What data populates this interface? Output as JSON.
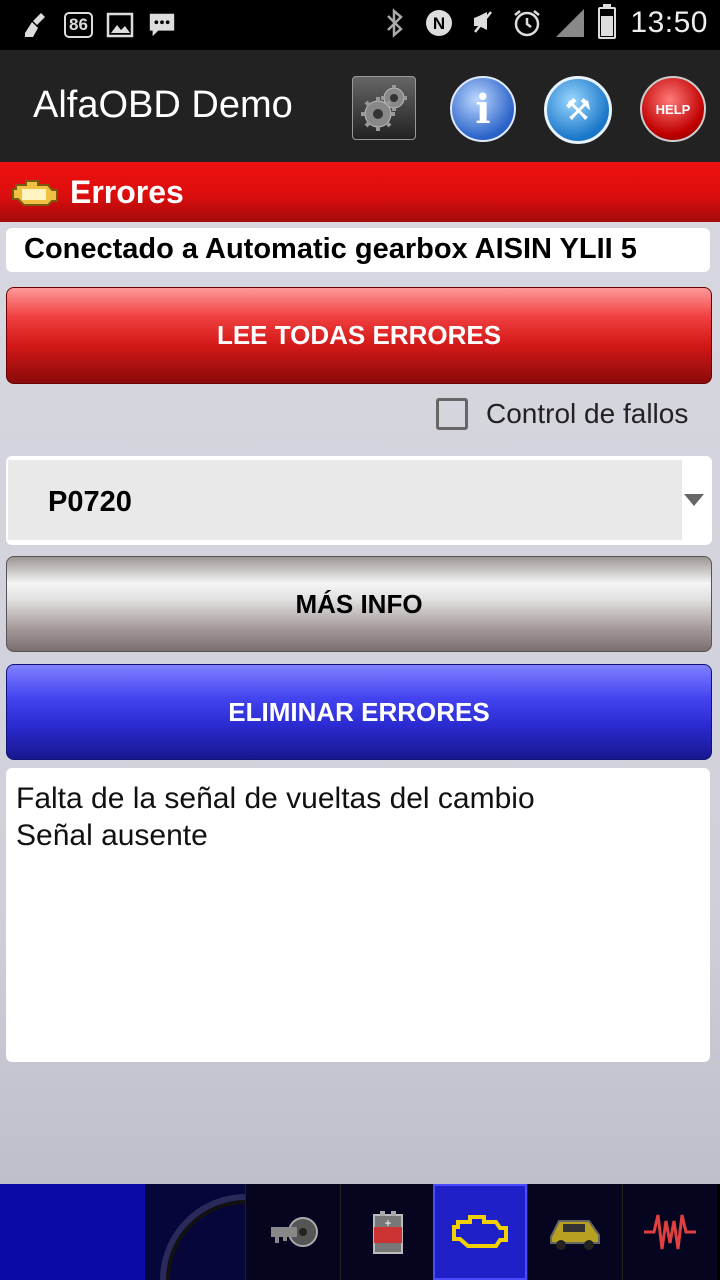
{
  "status_bar": {
    "notification_badge": "86",
    "time": "13:50",
    "icons": [
      "broom-icon",
      "image-icon",
      "sms-icon",
      "bluetooth-icon",
      "nfc-icon",
      "mute-icon",
      "alarm-icon",
      "signal-icon",
      "battery-icon"
    ]
  },
  "app_bar": {
    "title": "AlfaOBD Demo",
    "actions": [
      {
        "name": "settings-gear-icon"
      },
      {
        "name": "info-icon",
        "glyph": "i"
      },
      {
        "name": "tools-icon",
        "glyph": "⚒"
      },
      {
        "name": "help-icon",
        "glyph": "HELP"
      }
    ]
  },
  "section": {
    "title": "Errores",
    "icon": "engine-check-icon"
  },
  "connection_label": "Conectado a Automatic gearbox AISIN YLII 5",
  "buttons": {
    "read_all": "LEE TODAS ERRORES",
    "more_info": "MÁS INFO",
    "clear": "ELIMINAR ERRORES"
  },
  "fault_control": {
    "label": "Control de fallos",
    "checked": false
  },
  "error_code_select": {
    "selected": "P0720"
  },
  "description": {
    "lines": [
      "Falta de la señal de vueltas del cambio",
      "Señal ausente"
    ]
  },
  "bottom_tabs": [
    {
      "name": "ignition-key-icon"
    },
    {
      "name": "battery-tab-icon"
    },
    {
      "name": "engine-check-tab-icon",
      "active": true
    },
    {
      "name": "car-tab-icon"
    },
    {
      "name": "signal-wave-icon"
    }
  ],
  "colors": {
    "header_red": "#dd0d0d",
    "read_button_red": "#d41818",
    "clear_button_blue": "#2a2ad0",
    "app_bar_bg": "#222222",
    "active_tab_blue": "#2020c8"
  }
}
